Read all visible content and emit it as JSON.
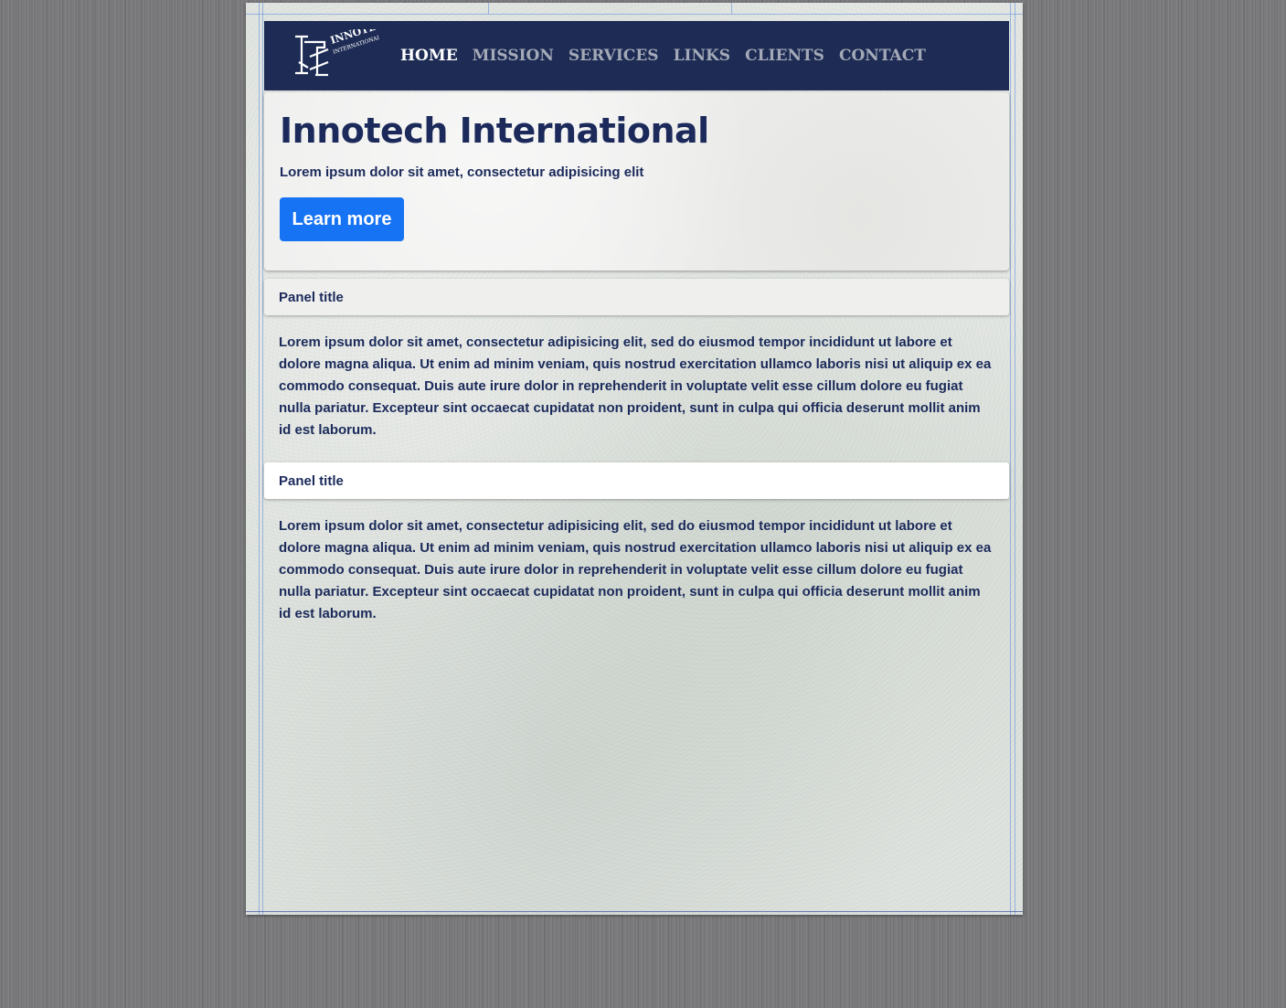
{
  "brand": {
    "logo_text_line1": "INNOTECH",
    "logo_text_line2": "INTERNATIONAL LLC",
    "logo_icon": "innotech-logo-icon"
  },
  "nav": {
    "items": [
      {
        "label": "HOME",
        "active": true
      },
      {
        "label": "MISSION",
        "active": false
      },
      {
        "label": "SERVICES",
        "active": false
      },
      {
        "label": "LINKS",
        "active": false
      },
      {
        "label": "CLIENTS",
        "active": false
      },
      {
        "label": "CONTACT",
        "active": false
      }
    ]
  },
  "jumbotron": {
    "title": "Innotech International",
    "subtitle": "Lorem ipsum dolor sit amet, consectetur adipisicing elit",
    "button_label": "Learn more"
  },
  "panels": [
    {
      "title": "Panel title",
      "body": "Lorem ipsum dolor sit amet, consectetur adipisicing elit, sed do eiusmod tempor incididunt ut labore et dolore magna aliqua. Ut enim ad minim veniam, quis nostrud exercitation ullamco laboris nisi ut aliquip ex ea commodo consequat. Duis aute irure dolor in reprehenderit in voluptate velit esse cillum dolore eu fugiat nulla pariatur. Excepteur sint occaecat cupidatat non proident, sunt in culpa qui officia deserunt mollit anim id est laborum."
    },
    {
      "title": "Panel title",
      "body": "Lorem ipsum dolor sit amet, consectetur adipisicing elit, sed do eiusmod tempor incididunt ut labore et dolore magna aliqua. Ut enim ad minim veniam, quis nostrud exercitation ullamco laboris nisi ut aliquip ex ea commodo consequat. Duis aute irure dolor in reprehenderit in voluptate velit esse cillum dolore eu fugiat nulla pariatur. Excepteur sint occaecat cupidatat non proident, sunt in culpa qui officia deserunt mollit anim id est laborum."
    }
  ],
  "colors": {
    "navbar_bg": "#1e2c55",
    "text_primary": "#1b2a5a",
    "button_bg": "#1673f4",
    "nav_inactive": "#a3a9b6",
    "page_background": "#7b7b7d"
  }
}
